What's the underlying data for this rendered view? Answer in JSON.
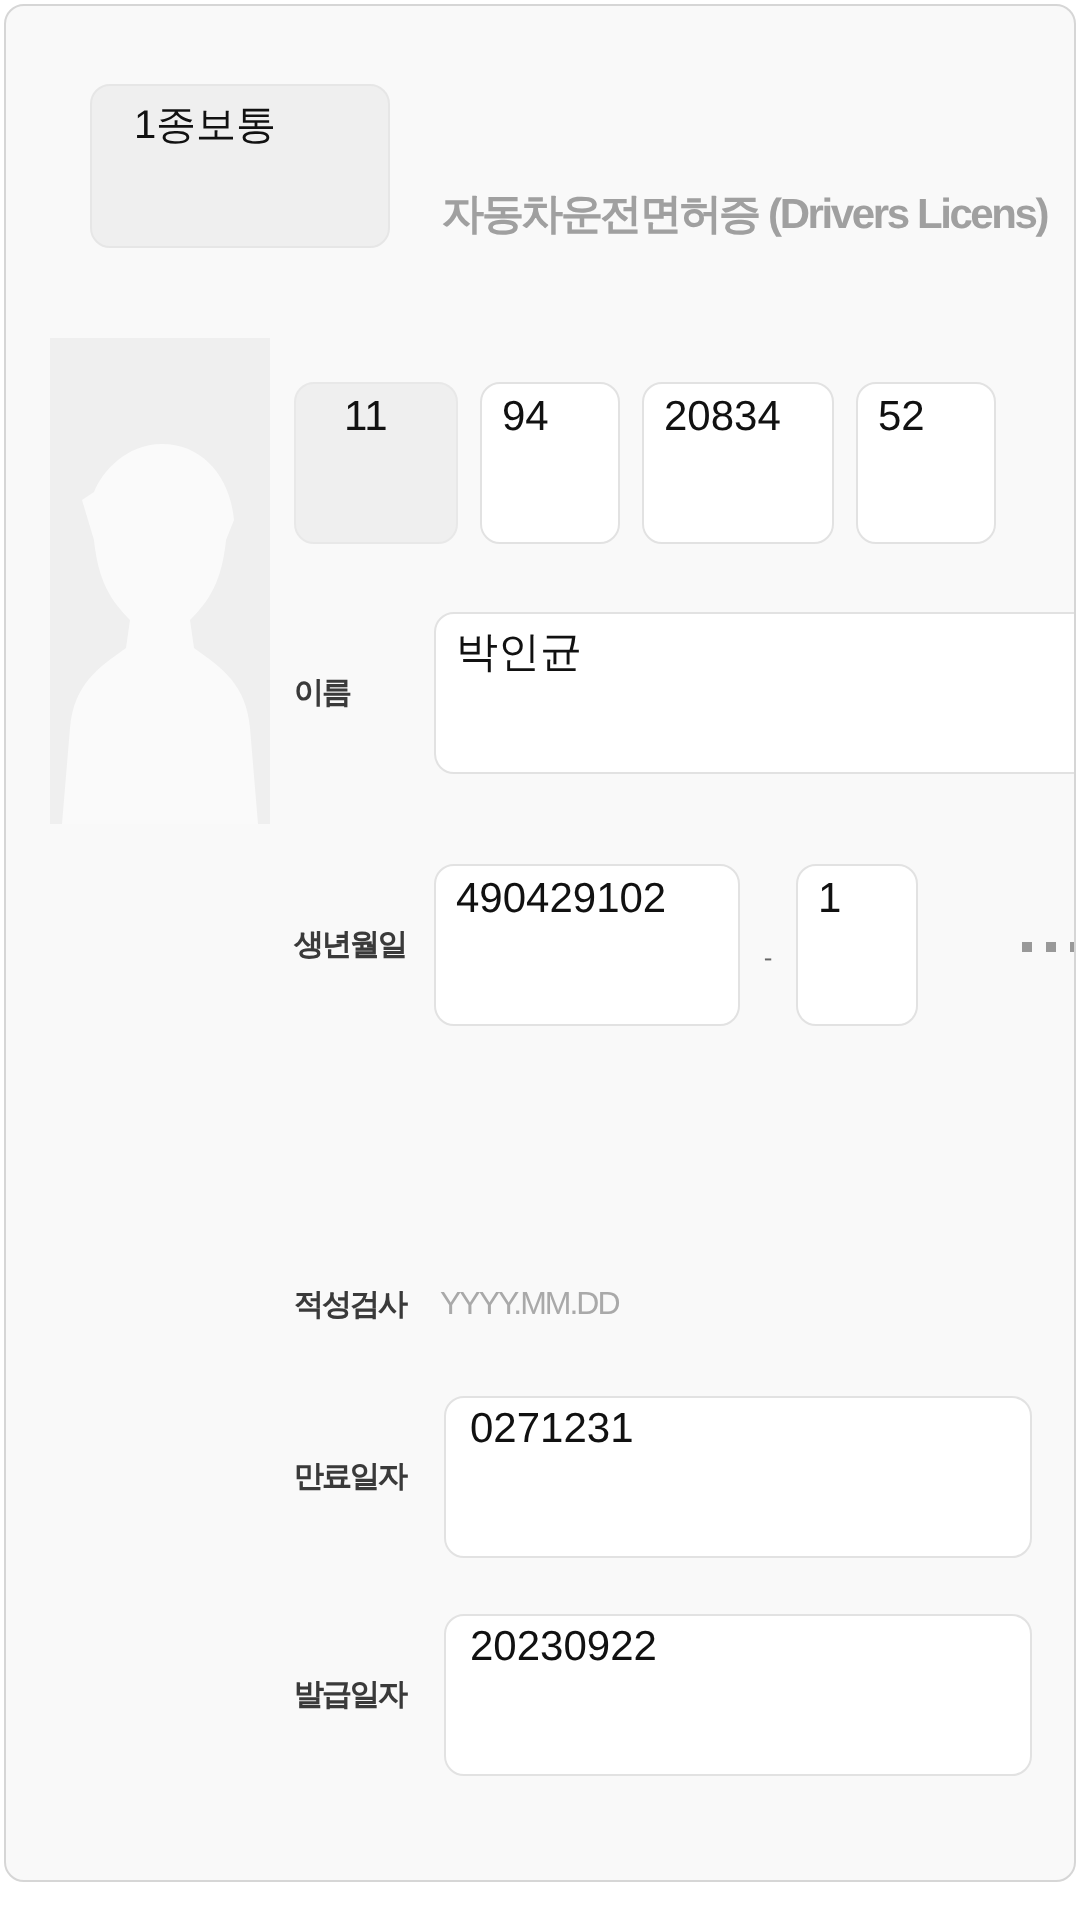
{
  "license_class": "1종보통",
  "title": "자동차운전면허증 (Drivers Licens)",
  "license_number": [
    {
      "value": "11",
      "disabled": true
    },
    {
      "value": "94",
      "disabled": false
    },
    {
      "value": "20834",
      "disabled": false
    },
    {
      "value": "52",
      "disabled": false
    }
  ],
  "name": {
    "label": "이름",
    "value": "박인균"
  },
  "birth": {
    "label": "생년월일",
    "value": "490429102",
    "separator": "-",
    "suffix": "1"
  },
  "aptitude_test": {
    "label": "적성검사",
    "placeholder": "YYYY.MM.DD"
  },
  "dates": [
    {
      "label": "만료일자",
      "value": "0271231"
    },
    {
      "label": "발급일자",
      "value": "20230922"
    }
  ]
}
